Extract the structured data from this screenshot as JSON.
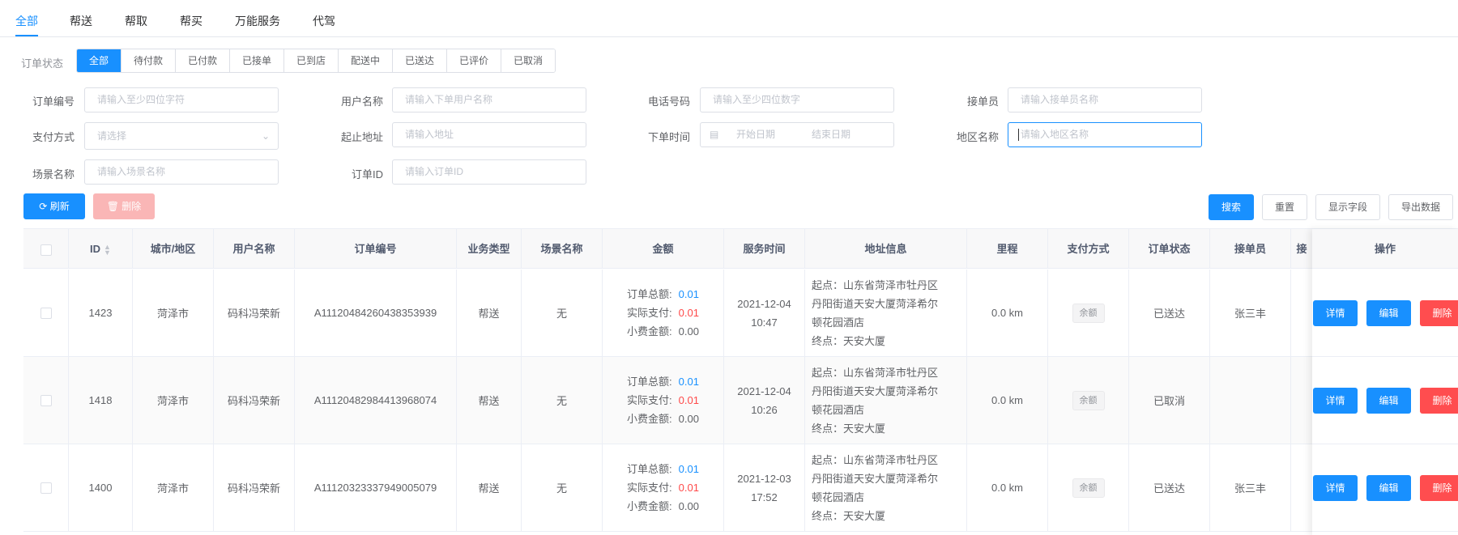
{
  "top_tabs": [
    "全部",
    "帮送",
    "帮取",
    "帮买",
    "万能服务",
    "代驾"
  ],
  "status": {
    "label": "订单状态",
    "tabs": [
      "全部",
      "待付款",
      "已付款",
      "已接单",
      "已到店",
      "配送中",
      "已送达",
      "已评价",
      "已取消"
    ],
    "active_index": 0
  },
  "filters": {
    "order_no": {
      "label": "订单编号",
      "placeholder": "请输入至少四位字符"
    },
    "user_name": {
      "label": "用户名称",
      "placeholder": "请输入下单用户名称"
    },
    "phone": {
      "label": "电话号码",
      "placeholder": "请输入至少四位数字"
    },
    "receiver": {
      "label": "接单员",
      "placeholder": "请输入接单员名称"
    },
    "pay_method": {
      "label": "支付方式",
      "placeholder": "请选择"
    },
    "address": {
      "label": "起止地址",
      "placeholder": "请输入地址"
    },
    "order_time": {
      "label": "下单时间",
      "start_placeholder": "开始日期",
      "end_placeholder": "结束日期"
    },
    "region": {
      "label": "地区名称",
      "placeholder": "请输入地区名称"
    },
    "scene": {
      "label": "场景名称",
      "placeholder": "请输入场景名称"
    },
    "order_id": {
      "label": "订单ID",
      "placeholder": "请输入订单ID"
    }
  },
  "actions": {
    "refresh": "刷新",
    "delete": "删除",
    "search": "搜索",
    "reset": "重置",
    "show_fields": "显示字段",
    "export": "导出数据"
  },
  "table": {
    "headers": [
      "ID",
      "城市/地区",
      "用户名称",
      "订单编号",
      "业务类型",
      "场景名称",
      "金额",
      "服务时间",
      "地址信息",
      "里程",
      "支付方式",
      "订单状态",
      "接单员",
      "接",
      "操作"
    ],
    "amount_labels": {
      "total": "订单总额:",
      "paid": "实际支付:",
      "tip": "小费金额:"
    },
    "op_labels": {
      "detail": "详情",
      "edit": "编辑",
      "delete": "删除"
    },
    "rows": [
      {
        "id": "1423",
        "city": "菏泽市",
        "user": "码科冯荣新",
        "order_no": "A11120484260438353939",
        "biz_type": "帮送",
        "scene": "无",
        "total": "0.01",
        "paid": "0.01",
        "tip": "0.00",
        "date": "2021-12-04",
        "time": "10:47",
        "addr_from": [
          "起点：山东省菏泽市牡丹区",
          "丹阳街道天安大厦菏泽希尔",
          "顿花园酒店"
        ],
        "addr_to": "终点：天安大厦",
        "mileage": "0.0 km",
        "pay": "余额",
        "status": "已送达",
        "receiver": "张三丰"
      },
      {
        "id": "1418",
        "city": "菏泽市",
        "user": "码科冯荣新",
        "order_no": "A11120482984413968074",
        "biz_type": "帮送",
        "scene": "无",
        "total": "0.01",
        "paid": "0.01",
        "tip": "0.00",
        "date": "2021-12-04",
        "time": "10:26",
        "addr_from": [
          "起点：山东省菏泽市牡丹区",
          "丹阳街道天安大厦菏泽希尔",
          "顿花园酒店"
        ],
        "addr_to": "终点：天安大厦",
        "mileage": "0.0 km",
        "pay": "余额",
        "status": "已取消",
        "receiver": ""
      },
      {
        "id": "1400",
        "city": "菏泽市",
        "user": "码科冯荣新",
        "order_no": "A11120323337949005079",
        "biz_type": "帮送",
        "scene": "无",
        "total": "0.01",
        "paid": "0.01",
        "tip": "0.00",
        "date": "2021-12-03",
        "time": "17:52",
        "addr_from": [
          "起点：山东省菏泽市牡丹区",
          "丹阳街道天安大厦菏泽希尔",
          "顿花园酒店"
        ],
        "addr_to": "终点：天安大厦",
        "mileage": "0.0 km",
        "pay": "余额",
        "status": "已送达",
        "receiver": "张三丰"
      }
    ]
  },
  "colors": {
    "primary": "#1890ff",
    "danger": "#ff4d4f",
    "paid_red": "#ff4949"
  }
}
